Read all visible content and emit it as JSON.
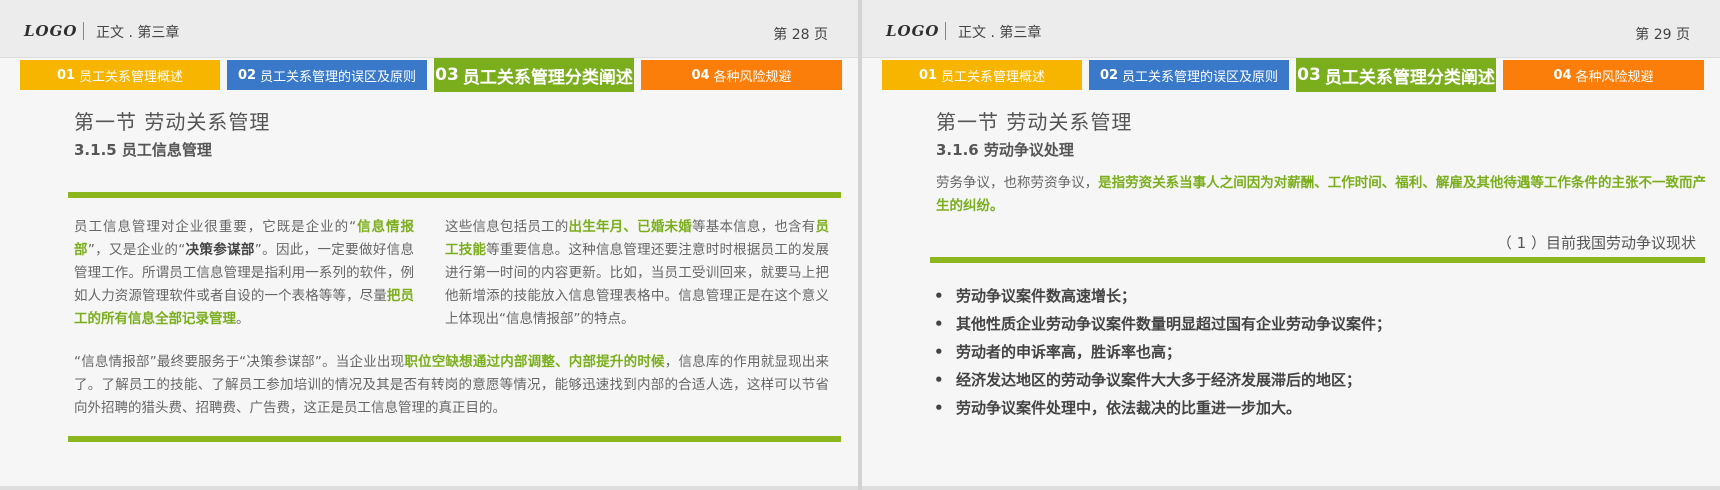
{
  "slides": [
    {
      "logo": "LOGO",
      "chapter": "正文 . 第三章",
      "page": "第 28 页",
      "tabs": [
        {
          "num": "01",
          "label": "员工关系管理概述"
        },
        {
          "num": "02",
          "label": "员工关系管理的误区及原则"
        },
        {
          "num": "03",
          "label": "员工关系管理分类阐述"
        },
        {
          "num": "04",
          "label": "各种风险规避"
        }
      ],
      "section_title": "第一节  劳动关系管理",
      "sub_title": "3.1.5 员工信息管理",
      "col1": {
        "p1": "员工信息管理对企业很重要，它既是企业的“",
        "h1": "信息情报部",
        "p2": "”，又是企业的“",
        "h2": "决策参谋部",
        "p3": "”。因此，一定要做好信息管理工作。所谓员工信息管理是指利用一系列的软件，例如人力资源管理软件或者自设的一个表格等等，尽量",
        "h3": "把员工的所有信息全部记录管理",
        "p4": "。"
      },
      "col2": {
        "p1": "这些信息包括员工的",
        "h1": "出生年月、已婚未婚",
        "p2": "等基本信息，也含有",
        "h2": "员工技能",
        "p3": "等重要信息。这种信息管理还要注意时时根据员工的发展进行第一时间的内容更新。比如，当员工受训回来，就要马上把他新增添的技能放入信息管理表格中。信息管理正是在这个意义上体现出“信息情报部”的特点。"
      },
      "para3": {
        "p1": "“信息情报部”最终要服务于“决策参谋部”。当企业出现",
        "h1": "职位空缺想通过内部调整、内部提升的时候",
        "p2": "，信息库的作用就显现出来了。了解员工的技能、了解员工参加培训的情况及其是否有转岗的意愿等情况，能够迅速找到内部的合适人选，这样可以节省向外招聘的猎头费、招聘费、广告费，这正是员工信息管理的真正目的。"
      }
    },
    {
      "logo": "LOGO",
      "chapter": "正文 . 第三章",
      "page": "第 29 页",
      "tabs": [
        {
          "num": "01",
          "label": "员工关系管理概述"
        },
        {
          "num": "02",
          "label": "员工关系管理的误区及原则"
        },
        {
          "num": "03",
          "label": "员工关系管理分类阐述"
        },
        {
          "num": "04",
          "label": "各种风险规避"
        }
      ],
      "section_title": "第一节  劳动关系管理",
      "sub_title": "3.1.6 劳动争议处理",
      "intro": {
        "p1": "劳务争议，也称劳资争议，",
        "h1": "是指劳资关系当事人之间因为对薪酬、工作时间、福利、解雇及其他待遇等工作条件的主张不一致而产生的纠纷。"
      },
      "status": "（ 1 ）目前我国劳动争议现状",
      "bullet_symbol": "•",
      "bullets": [
        "劳动争议案件数高速增长；",
        "其他性质企业劳动争议案件数量明显超过国有企业劳动争议案件；",
        "劳动者的申诉率高，胜诉率也高；",
        "经济发达地区的劳动争议案件大大多于经济发展滞后的地区；",
        "劳动争议案件处理中，依法裁决的比重进一步加大。"
      ]
    }
  ],
  "colors": {
    "yellow": "#f7b500",
    "blue": "#3a79c9",
    "green": "#7aae1c",
    "orange": "#fb7e0a",
    "accent_line": "#8db51e"
  }
}
